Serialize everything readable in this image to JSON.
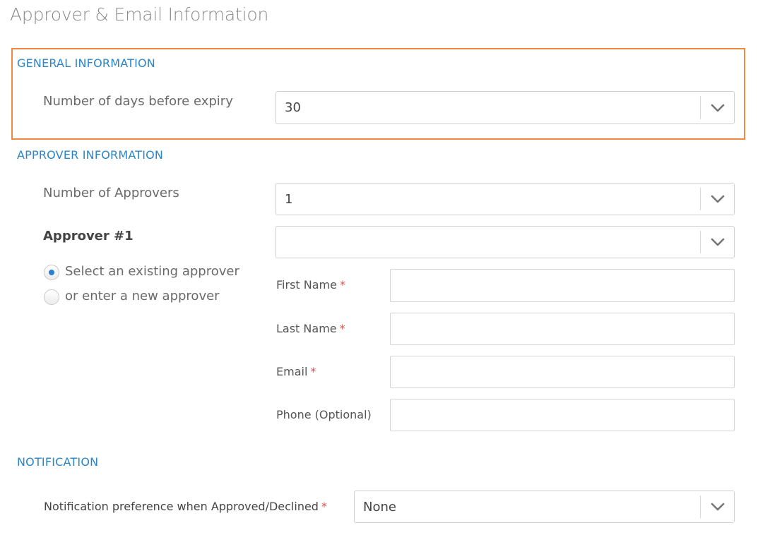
{
  "page": {
    "title": "Approver & Email Information"
  },
  "general": {
    "heading": "GENERAL INFORMATION",
    "expiry_label": "Number of days before expiry",
    "expiry_value": "30"
  },
  "approver": {
    "heading": "APPROVER INFORMATION",
    "count_label": "Number of Approvers",
    "count_value": "1",
    "approver_title": "Approver #1",
    "approver_select_value": "",
    "radio_existing": "Select an existing approver",
    "radio_new": "or enter a new approver",
    "selected_option": "existing",
    "fields": {
      "first_name": "First Name",
      "last_name": "Last Name",
      "email": "Email",
      "phone": "Phone (Optional)",
      "required_mark": "*"
    }
  },
  "notification": {
    "heading": "NOTIFICATION",
    "pref_label": "Notification preference when Approved/Declined",
    "pref_value": "None"
  },
  "colors": {
    "accent": "#2b85c9",
    "highlight": "#f0883e",
    "required": "#d9534f"
  },
  "icons": {
    "dropdown": "chevron-down-icon"
  }
}
